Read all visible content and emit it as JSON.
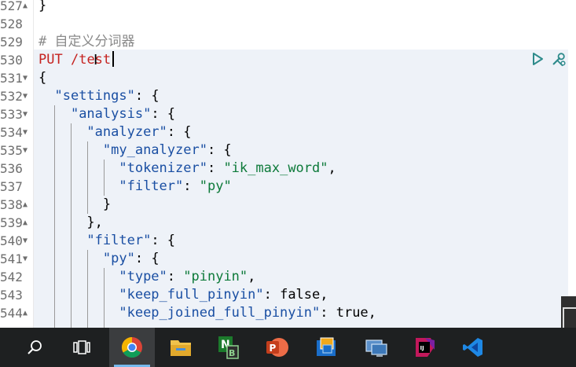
{
  "gutter": {
    "line_numbers": [
      "527",
      "528",
      "529",
      "530",
      "531",
      "532",
      "533",
      "534",
      "535",
      "536",
      "537",
      "538",
      "539",
      "540",
      "541",
      "542",
      "543",
      "544"
    ]
  },
  "code": {
    "line_527": "}",
    "comment": "# 自定义分词器",
    "method": "PUT",
    "path": "/test",
    "open_brace": "{",
    "settings_key": "\"settings\"",
    "analysis_key": "\"analysis\"",
    "analyzer_key": "\"analyzer\"",
    "my_analyzer_key": "\"my_analyzer\"",
    "tokenizer_key": "\"tokenizer\"",
    "tokenizer_value": "\"ik_max_word\"",
    "filter_key": "\"filter\"",
    "filter_value": "\"py\"",
    "close_brace": "}",
    "close_brace_comma": "},",
    "filter_section_key": "\"filter\"",
    "py_key": "\"py\"",
    "type_key": "\"type\"",
    "type_value": "\"pinyin\"",
    "keep_full_pinyin_key": "\"keep_full_pinyin\"",
    "keep_full_pinyin_value": "false",
    "keep_joined_full_pinyin_key": "\"keep_joined_full_pinyin\"",
    "keep_joined_full_pinyin_value": "true"
  },
  "actions": {
    "run_icon": "play-icon",
    "settings_icon": "wrench-icon",
    "run_color": "#2e8b8b"
  },
  "taskbar": {
    "icons": [
      "search-icon",
      "task-view-icon",
      "chrome-icon",
      "file-explorer-icon",
      "notepad-plus-plus-icon",
      "powerpoint-icon",
      "virtualbox-icon",
      "remote-desktop-icon",
      "intellij-idea-icon",
      "vscode-icon"
    ],
    "background": "#1e2021"
  }
}
